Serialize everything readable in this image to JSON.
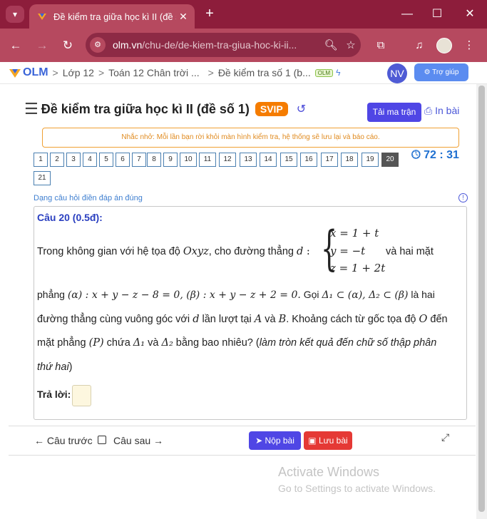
{
  "browser": {
    "tab_title": "Đề kiểm tra giữa học kì II (đề số",
    "url_host": "olm.vn",
    "url_path": "/chu-de/de-kiem-tra-giua-hoc-ki-ii..."
  },
  "breadcrumb": {
    "logo": "OLM",
    "items": [
      "Lớp 12",
      "Toán 12 Chân trời ...",
      "Đề kiểm tra số 1 (b..."
    ],
    "badge": "OLM"
  },
  "user": {
    "initials": "NV",
    "help_label": "Trợ giúp"
  },
  "page": {
    "title": "Đề kiểm tra giữa học kì II (đề số 1)",
    "svip": "SVIP",
    "matrix_button": "Tải ma trận",
    "print_button": "In bài",
    "notice": "Nhắc nhở: Mỗi lần bạn rời khỏi màn hình kiểm tra, hệ thống sẽ lưu lại và báo cáo.",
    "timer": "72 : 31",
    "question_numbers": [
      "1",
      "2",
      "3",
      "4",
      "5",
      "6",
      "7",
      "8",
      "9",
      "10",
      "11",
      "12",
      "13",
      "14",
      "15",
      "16",
      "17",
      "18",
      "19",
      "20",
      "21"
    ],
    "active_question": "20",
    "question_type": "Dạng câu hỏi điền đáp án đúng"
  },
  "question": {
    "header": "Câu 20 (0.5đ):",
    "line1_a": "Trong không gian với hệ tọa độ ",
    "line1_oxyz": "Oxyz",
    "line1_b": ", cho đường thẳng ",
    "line1_d": "d",
    "line1_c": " :",
    "sys1": "x = 1 + t",
    "sys2": "y = −t",
    "sys3": "z = 1 + 2t",
    "line1_end": "và hai mặt",
    "line2_a": "phẳng ",
    "line2_math": "(α) : x + y − z − 8 = 0, (β) : x + y − z + 2 = 0.",
    "line2_b": " Gọi ",
    "line2_math2": "Δ₁ ⊂ (α), Δ₂ ⊂ (β)",
    "line2_c": " là hai",
    "line3_a": "đường thẳng cùng vuông góc với ",
    "line3_d": "d",
    "line3_b": " lần lượt tại ",
    "line3_A": "A",
    "line3_c": " và ",
    "line3_B": "B",
    "line3_e": ". Khoảng cách từ gốc tọa độ ",
    "line3_O": "O",
    "line3_f": " đến",
    "line4_a": "mặt phẳng ",
    "line4_P": "(P)",
    "line4_b": " chứa ",
    "line4_d1": "Δ₁",
    "line4_c": " và ",
    "line4_d2": "Δ₂",
    "line4_d": " bằng bao nhiêu? (",
    "line4_note": "làm tròn kết quả đến chữ số thập phân",
    "line5_note": "thứ hai",
    "line5_end": ")",
    "answer_label": "Trả lời:"
  },
  "footer": {
    "prev": "Câu trước",
    "next": "Câu sau",
    "submit": "Nộp bài",
    "save": "Lưu bài"
  },
  "watermark": {
    "title": "Activate Windows",
    "subtitle": "Go to Settings to activate Windows."
  }
}
